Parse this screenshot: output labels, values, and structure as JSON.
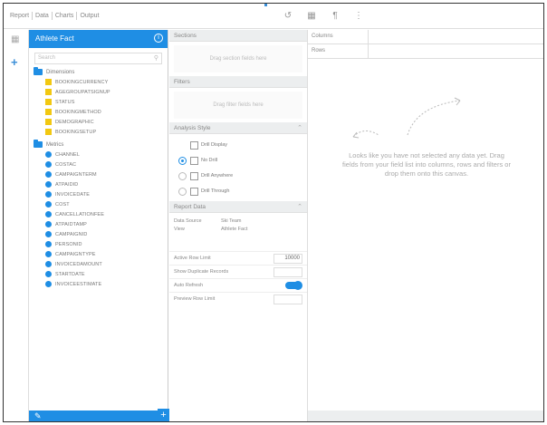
{
  "top": {
    "tabs": [
      "Report",
      "Data",
      "Charts",
      "Output"
    ],
    "tools": [
      "undo-icon",
      "table-icon",
      "format-icon",
      "more-icon"
    ]
  },
  "field_panel": {
    "title": "Athlete Fact",
    "search_placeholder": "Search",
    "folders": [
      {
        "label": "Dimensions",
        "type": "dimension",
        "items": [
          "BOOKINGCURRENCY",
          "AGEGROUPATSIGNUP",
          "STATUS",
          "BOOKINGMETHOD",
          "DEMOGRAPHIC",
          "BOOKINGSETUP"
        ]
      },
      {
        "label": "Metrics",
        "type": "metric",
        "items": [
          "CHANNEL",
          "COSTAC",
          "CAMPAIGNTERM",
          "ATPAIDID",
          "INVOICEDATE",
          "COST",
          "CANCELLATIONFEE",
          "ATPAIDTAMP",
          "CAMPAIGNID",
          "PERSONID",
          "CAMPAIGNTYPE",
          "INVOICEDAMOUNT",
          "STARTDATE",
          "INVOICEESTIMATE"
        ]
      }
    ]
  },
  "config": {
    "sections_header": "Sections",
    "sections_drop": "Drag section fields here",
    "filters_header": "Filters",
    "filters_drop": "Drag filter fields here",
    "analysis_header": "Analysis Style",
    "analysis_options": [
      "Drill Display",
      "No Drill",
      "Drill Anywhere",
      "Drill Through"
    ],
    "analysis_selected": 1,
    "report_header": "Report Data",
    "report_kv": [
      {
        "k": "Data Source",
        "v": "Ski Team"
      },
      {
        "k": "View",
        "v": "Athlete Fact"
      }
    ],
    "active_row_limit_label": "Active Row Limit",
    "active_row_limit_value": "10000",
    "show_duplicates_label": "Show Duplicate Records",
    "auto_refresh_label": "Auto Refresh",
    "auto_refresh_on": true,
    "preview_row_limit_label": "Preview Row Limit"
  },
  "canvas": {
    "columns_label": "Columns",
    "rows_label": "Rows",
    "message": "Looks like you have not selected any data yet. Drag fields from your field list into columns, rows and filters or drop them onto this canvas."
  }
}
